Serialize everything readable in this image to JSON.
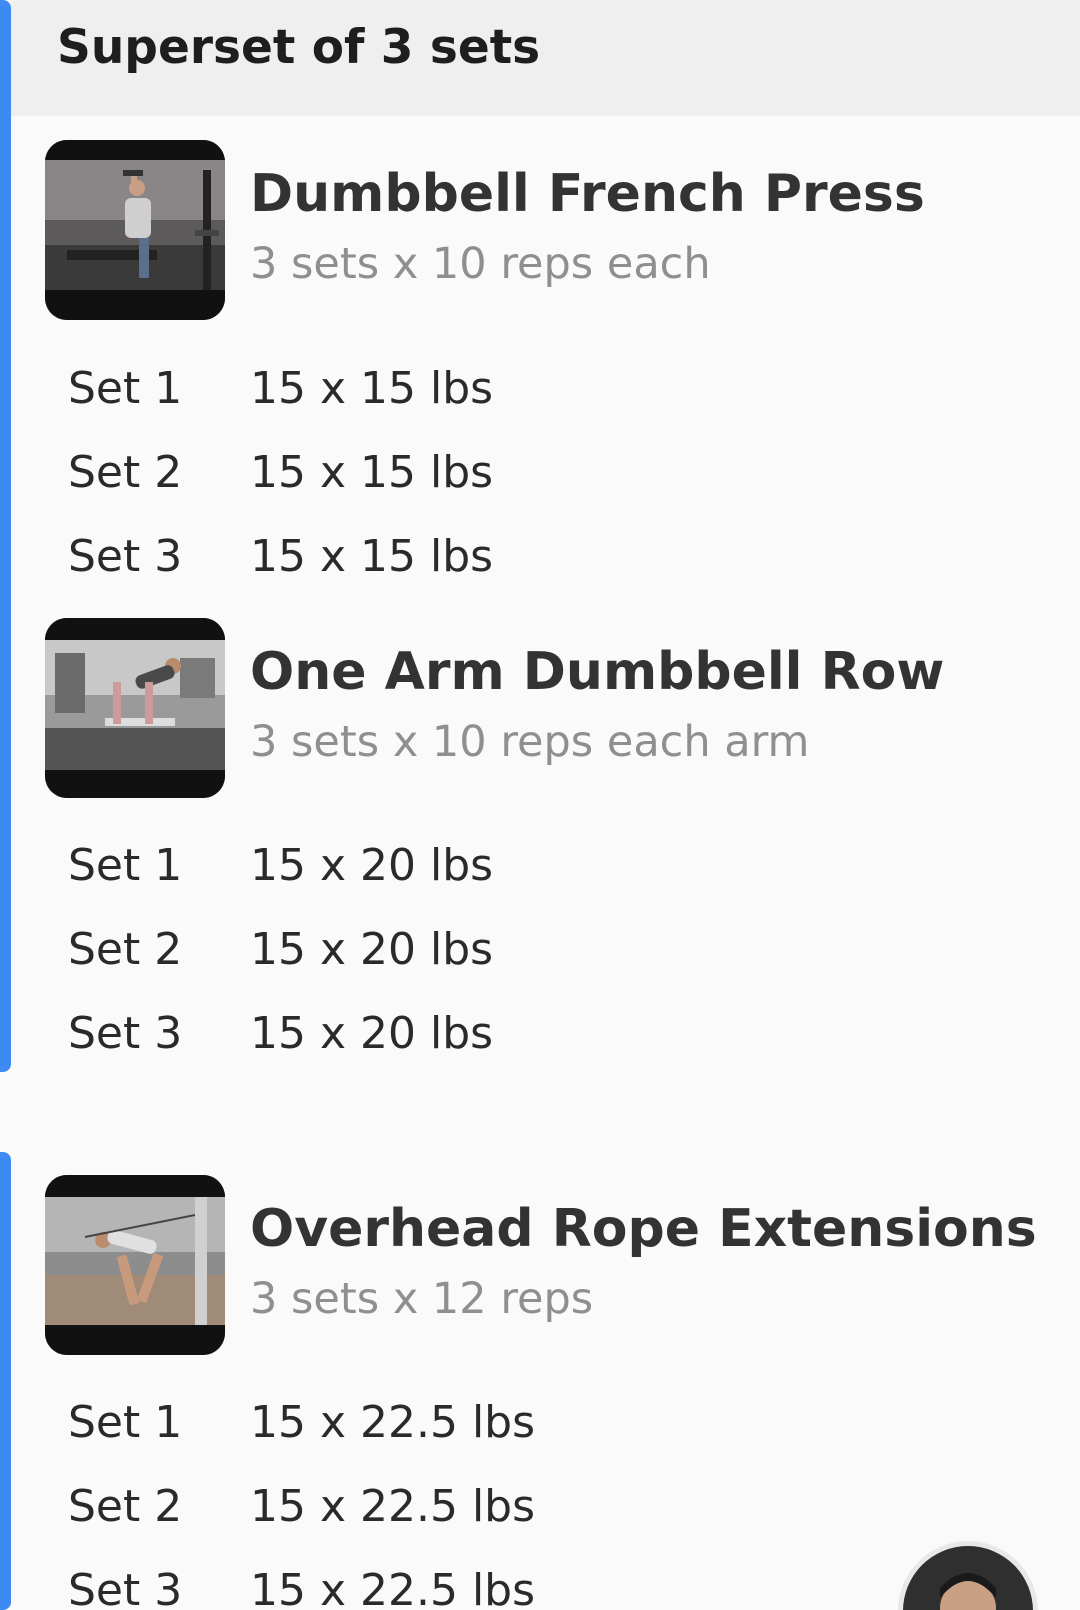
{
  "superset": {
    "title": "Superset of 3 sets"
  },
  "exercises": [
    {
      "name": "Dumbbell French Press",
      "prescription": "3 sets x 10 reps each",
      "sets": [
        {
          "label": "Set 1",
          "value": "15 x 15 lbs"
        },
        {
          "label": "Set 2",
          "value": "15 x 15 lbs"
        },
        {
          "label": "Set 3",
          "value": "15 x 15 lbs"
        }
      ]
    },
    {
      "name": "One Arm Dumbbell Row",
      "prescription": "3 sets x 10 reps each arm",
      "sets": [
        {
          "label": "Set 1",
          "value": "15 x 20 lbs"
        },
        {
          "label": "Set 2",
          "value": "15 x 20 lbs"
        },
        {
          "label": "Set 3",
          "value": "15 x 20 lbs"
        }
      ]
    },
    {
      "name": "Overhead Rope Extensions",
      "prescription": "3 sets x 12 reps",
      "sets": [
        {
          "label": "Set 1",
          "value": "15 x 22.5 lbs"
        },
        {
          "label": "Set 2",
          "value": "15 x 22.5 lbs"
        },
        {
          "label": "Set 3",
          "value": "15 x 22.5 lbs"
        }
      ]
    }
  ],
  "colors": {
    "accent": "#3d8bf2",
    "header_bg": "#efefef",
    "page_bg": "#fafafa",
    "secondary_text": "#8f8f8f"
  }
}
